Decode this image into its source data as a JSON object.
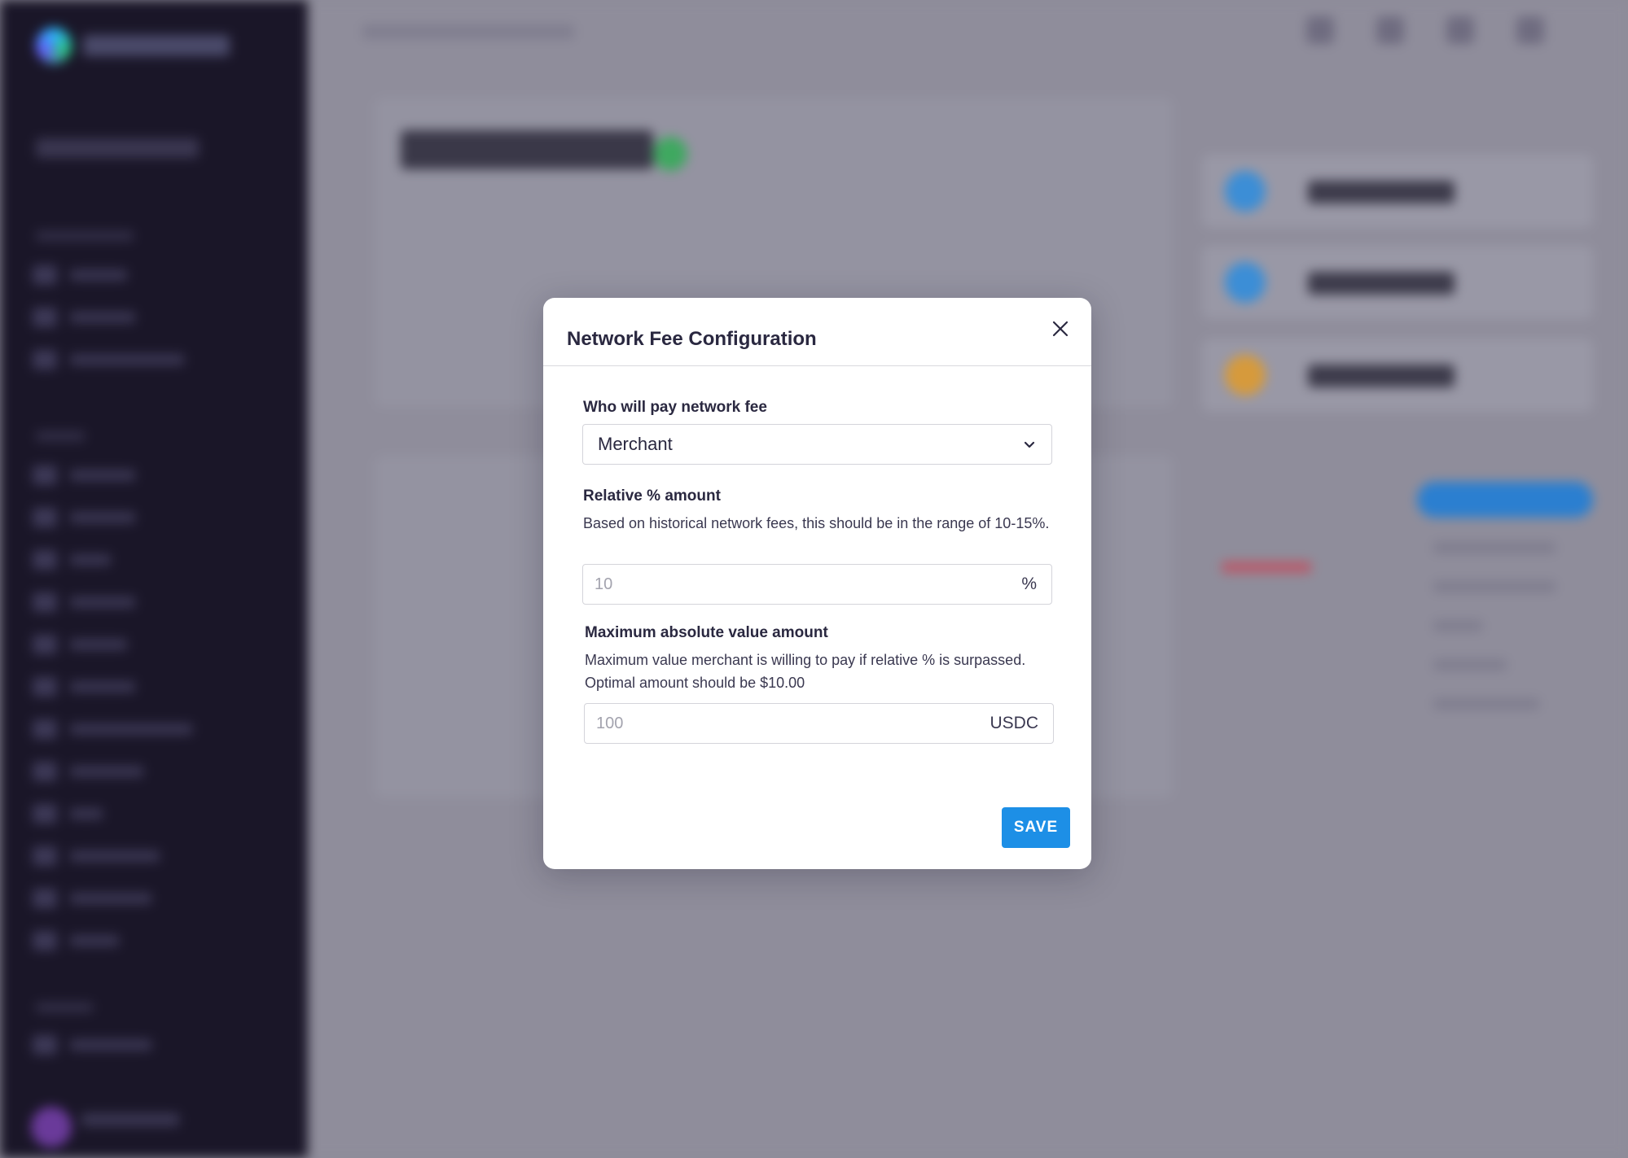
{
  "modal": {
    "title": "Network Fee Configuration",
    "payer": {
      "label": "Who will pay network fee",
      "selected": "Merchant"
    },
    "relative": {
      "label": "Relative % amount",
      "help": "Based on historical network fees, this should be in the range of 10-15%.",
      "placeholder": "10",
      "suffix": "%"
    },
    "maximum": {
      "label": "Maximum absolute value amount",
      "help": "Maximum value merchant is willing to pay if relative % is surpassed. Optimal amount should be $10.00",
      "placeholder": "100",
      "suffix": "USDC"
    },
    "save_label": "SAVE"
  },
  "icons": {
    "close": "close-icon",
    "dropdown": "chevron-down-icon"
  },
  "colors": {
    "primary": "#1d8fe6",
    "sidebar": "#1a1628",
    "overlay": "#8d8b98"
  }
}
